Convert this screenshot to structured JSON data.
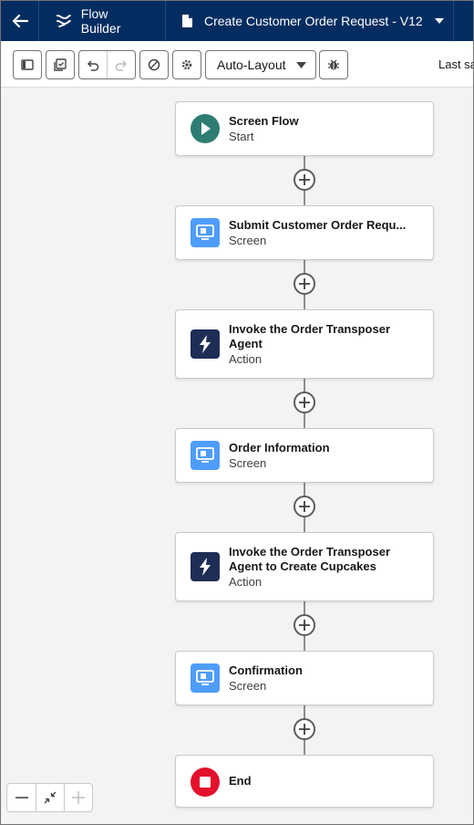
{
  "header": {
    "app_label": "Flow Builder",
    "flow_label": "Create Customer Order Request - V12",
    "bg_color": "#032d60"
  },
  "toolbar": {
    "layout_select": "Auto-Layout",
    "last_saved": "Last sa"
  },
  "nodes": [
    {
      "title": "Screen Flow",
      "subtitle": "Start",
      "icon": "play-icon",
      "color": "#2e7d72"
    },
    {
      "title": "Submit Customer Order Requ...",
      "subtitle": "Screen",
      "icon": "screen-icon",
      "color": "#4f9dfa"
    },
    {
      "title": "Invoke the Order Transposer Agent",
      "subtitle": "Action",
      "icon": "lightning-icon",
      "color": "#1e2d55"
    },
    {
      "title": "Order Information",
      "subtitle": "Screen",
      "icon": "screen-icon",
      "color": "#4f9dfa"
    },
    {
      "title": "Invoke the Order Transposer Agent to Create Cupcakes",
      "subtitle": "Action",
      "icon": "lightning-icon",
      "color": "#1e2d55"
    },
    {
      "title": "Confirmation",
      "subtitle": "Screen",
      "icon": "screen-icon",
      "color": "#4f9dfa"
    },
    {
      "title": "End",
      "subtitle": "",
      "icon": "stop-icon",
      "color": "#e3112b"
    }
  ]
}
